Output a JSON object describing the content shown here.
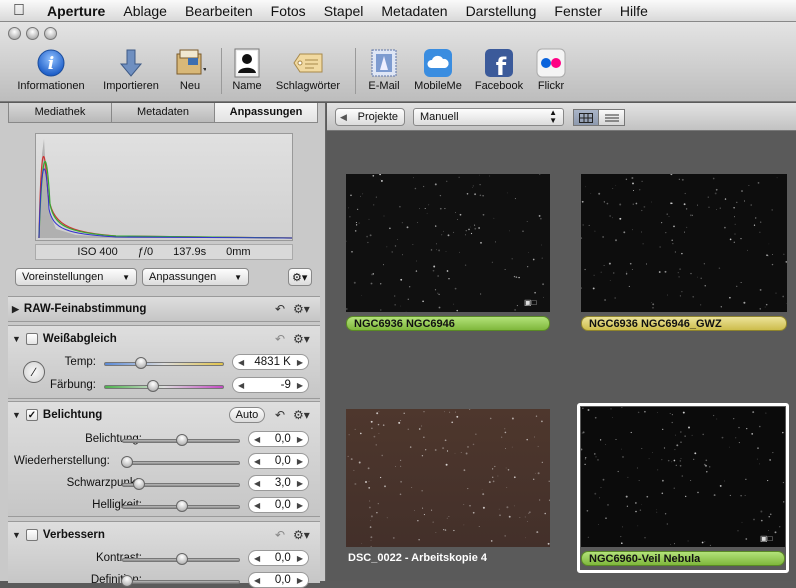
{
  "menubar": {
    "items": [
      "Aperture",
      "Ablage",
      "Bearbeiten",
      "Fotos",
      "Stapel",
      "Metadaten",
      "Darstellung",
      "Fenster",
      "Hilfe"
    ]
  },
  "toolbar": {
    "buttons": [
      {
        "label": "Informationen",
        "icon": "info-icon"
      },
      {
        "label": "Importieren",
        "icon": "import-arrow-icon"
      },
      {
        "label": "Neu",
        "icon": "new-project-icon"
      },
      {
        "label": "Name",
        "icon": "person-silhouette-icon"
      },
      {
        "label": "Schlagwörter",
        "icon": "keyword-tag-icon"
      },
      {
        "label": "E-Mail",
        "icon": "email-stamp-icon"
      },
      {
        "label": "MobileMe",
        "icon": "cloud-icon"
      },
      {
        "label": "Facebook",
        "icon": "facebook-icon"
      },
      {
        "label": "Flickr",
        "icon": "flickr-icon"
      }
    ]
  },
  "inspector": {
    "tabs": [
      "Mediathek",
      "Metadaten",
      "Anpassungen"
    ],
    "active_tab": "Anpassungen",
    "exif": {
      "iso": "ISO 400",
      "aperture": "ƒ/0",
      "shutter": "137.9s",
      "focal": "0mm"
    },
    "presets_button": "Voreinstellungen",
    "adjustments_button": "Anpassungen",
    "sections": {
      "raw": {
        "title": "RAW-Feinabstimmung"
      },
      "white_balance": {
        "title": "Weißabgleich",
        "checked": false,
        "temp_label": "Temp:",
        "temp_value": "4831 K",
        "tint_label": "Färbung:",
        "tint_value": "-9"
      },
      "exposure": {
        "title": "Belichtung",
        "checked": true,
        "auto_label": "Auto",
        "rows": [
          {
            "label": "Belichtung:",
            "value": "0,0"
          },
          {
            "label": "Wiederherstellung:",
            "value": "0,0"
          },
          {
            "label": "Schwarzpunkt:",
            "value": "3,0"
          },
          {
            "label": "Helligkeit:",
            "value": "0,0"
          }
        ]
      },
      "enhance": {
        "title": "Verbessern",
        "checked": false,
        "rows": [
          {
            "label": "Kontrast:",
            "value": "0,0"
          },
          {
            "label": "Definition:",
            "value": "0,0"
          }
        ]
      }
    }
  },
  "browser": {
    "back_button": "Projekte",
    "sort_select": "Manuell",
    "thumbnails": [
      {
        "caption": "NGC6936 NGC6946",
        "label_color": "#8fc94a",
        "bg": "#101010"
      },
      {
        "caption": "NGC6936 NGC6946_GWZ",
        "label_color": "#d7cc5a",
        "bg": "#0d0d0d"
      },
      {
        "caption": "DSC_0022 - Arbeitskopie 4",
        "label_color": "",
        "bg": "#4a352c"
      },
      {
        "caption": "NGC6960-Veil Nebula",
        "label_color": "#8fc94a",
        "bg": "#0b0b0b"
      }
    ]
  }
}
